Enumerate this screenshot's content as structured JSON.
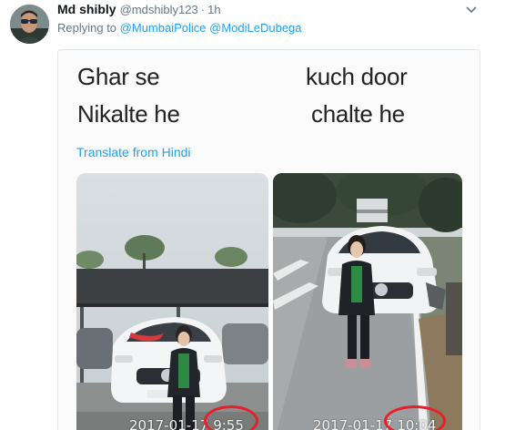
{
  "tweet": {
    "display_name": "Md shibly",
    "handle": "@mdshibly123",
    "separator": "·",
    "time_ago": "1h",
    "reply_prefix": "Replying to",
    "reply_mention_1": "@MumbaiPolice",
    "reply_mention_2": "@ModiLeDubega"
  },
  "card": {
    "text_top_left": "Ghar se",
    "text_top_right": "kuch door",
    "text_bottom_left": "Nikalte he",
    "text_bottom_right": "chalte he",
    "translate_label": "Translate from Hindi"
  },
  "photos": {
    "left": {
      "date": "2017-01-17",
      "time": "9:55"
    },
    "right": {
      "date": "2017-01-17",
      "time": "10:04"
    }
  },
  "icons": {
    "caret": "chevron-down-icon"
  },
  "colors": {
    "link": "#1da1f2",
    "muted": "#657786",
    "highlight_ring": "#e5202a"
  }
}
